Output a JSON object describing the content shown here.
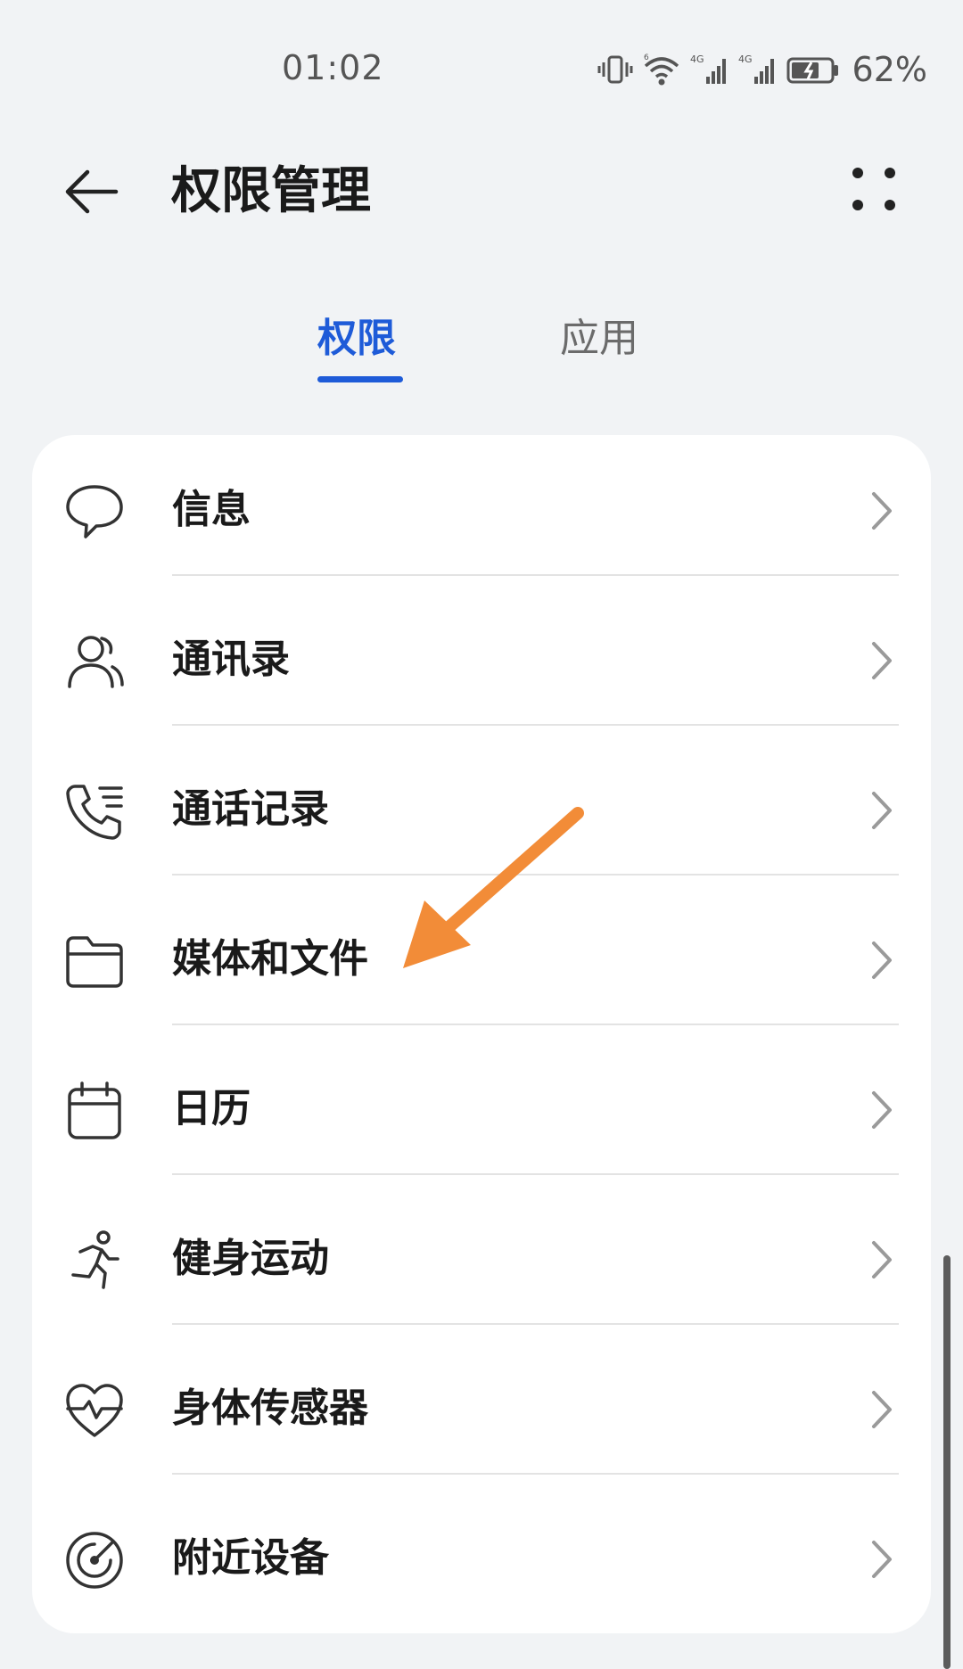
{
  "status_bar": {
    "time": "01:02",
    "battery_percent": "62%",
    "icons": [
      "vibrate-icon",
      "wifi-6-icon",
      "signal-4g-icon",
      "signal-4g-icon",
      "battery-icon"
    ]
  },
  "app_bar": {
    "title": "权限管理",
    "back_icon": "back-arrow-icon",
    "more_icon": "more-dots-icon"
  },
  "tabs": [
    {
      "label": "权限",
      "active": true
    },
    {
      "label": "应用",
      "active": false
    }
  ],
  "colors": {
    "accent": "#1e5bd8",
    "background": "#f1f3f5",
    "card": "#ffffff",
    "annotation_arrow": "#f28c38"
  },
  "permissions": [
    {
      "label": "信息",
      "icon": "message-bubble-icon"
    },
    {
      "label": "通讯录",
      "icon": "contacts-icon"
    },
    {
      "label": "通话记录",
      "icon": "call-log-icon"
    },
    {
      "label": "媒体和文件",
      "icon": "folder-icon"
    },
    {
      "label": "日历",
      "icon": "calendar-icon"
    },
    {
      "label": "健身运动",
      "icon": "running-icon"
    },
    {
      "label": "身体传感器",
      "icon": "heart-pulse-icon"
    },
    {
      "label": "附近设备",
      "icon": "nearby-radar-icon"
    }
  ]
}
